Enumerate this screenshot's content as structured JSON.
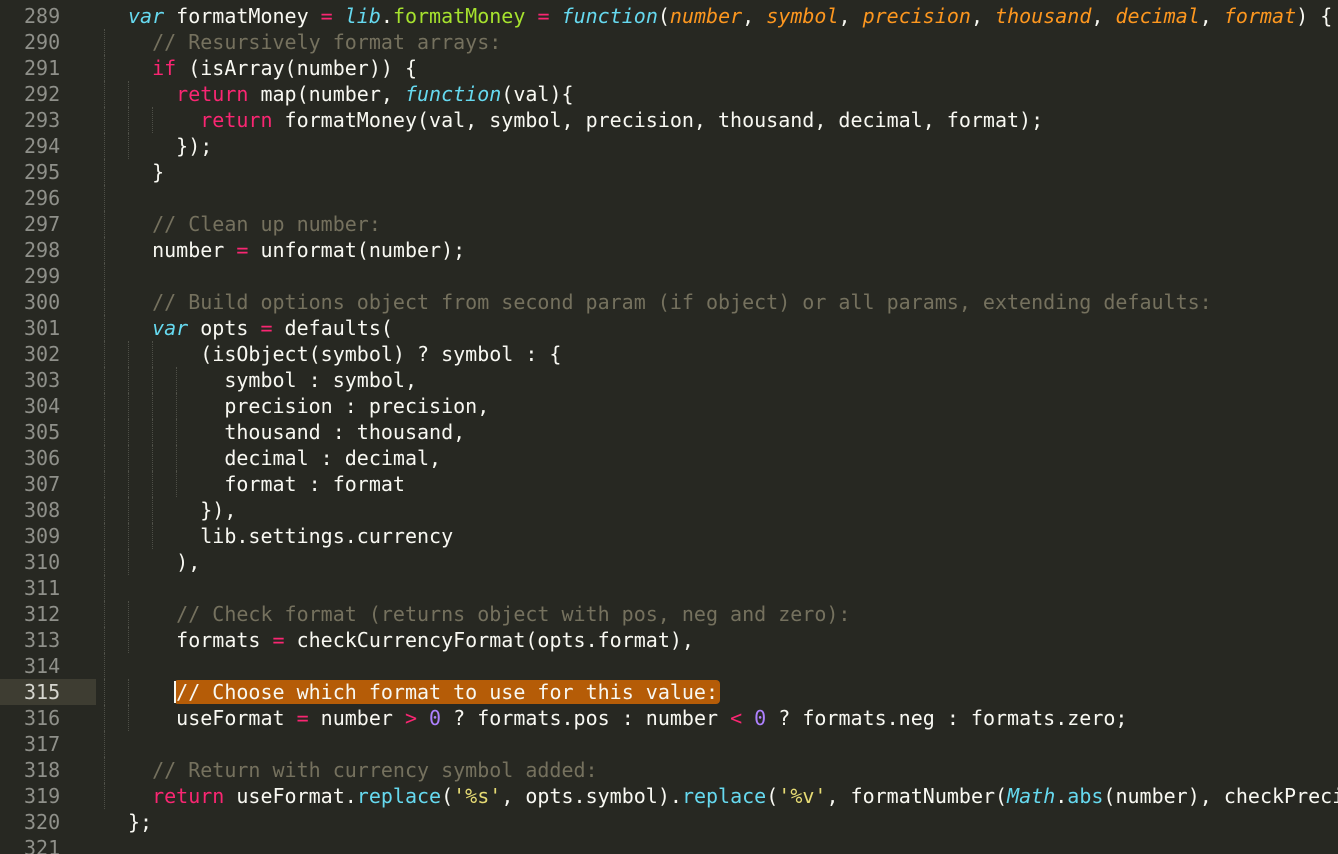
{
  "editor": {
    "active_line": 315,
    "colors": {
      "background": "#272822",
      "text": "#f8f8f2",
      "comment": "#75715e",
      "keyword": "#f92672",
      "storage": "#66d9ef",
      "function_name": "#a6e22e",
      "parameter": "#fd971f",
      "number": "#ae81ff",
      "string": "#e6db74",
      "line_number": "#8f908a",
      "selection_highlight": "#b55c07"
    },
    "lines": [
      {
        "number": "289",
        "tokens": [
          {
            "t": "var",
            "c": "storage"
          },
          {
            "t": " formatMoney ",
            "c": "plain"
          },
          {
            "t": "=",
            "c": "operator"
          },
          {
            "t": " ",
            "c": "plain"
          },
          {
            "t": "lib",
            "c": "storage"
          },
          {
            "t": ".",
            "c": "plain"
          },
          {
            "t": "formatMoney",
            "c": "func"
          },
          {
            "t": " ",
            "c": "plain"
          },
          {
            "t": "=",
            "c": "operator"
          },
          {
            "t": " ",
            "c": "plain"
          },
          {
            "t": "function",
            "c": "storage"
          },
          {
            "t": "(",
            "c": "plain"
          },
          {
            "t": "number",
            "c": "param"
          },
          {
            "t": ", ",
            "c": "plain"
          },
          {
            "t": "symbol",
            "c": "param"
          },
          {
            "t": ", ",
            "c": "plain"
          },
          {
            "t": "precision",
            "c": "param"
          },
          {
            "t": ", ",
            "c": "plain"
          },
          {
            "t": "thousand",
            "c": "param"
          },
          {
            "t": ", ",
            "c": "plain"
          },
          {
            "t": "decimal",
            "c": "param"
          },
          {
            "t": ", ",
            "c": "plain"
          },
          {
            "t": "format",
            "c": "param"
          },
          {
            "t": ") {",
            "c": "plain"
          }
        ]
      },
      {
        "number": "290",
        "tokens": [
          {
            "t": "  // Resursively format arrays:",
            "c": "comment"
          }
        ]
      },
      {
        "number": "291",
        "tokens": [
          {
            "t": "  ",
            "c": "plain"
          },
          {
            "t": "if",
            "c": "keyword"
          },
          {
            "t": " (isArray(number)) {",
            "c": "plain"
          }
        ]
      },
      {
        "number": "292",
        "tokens": [
          {
            "t": "    ",
            "c": "plain"
          },
          {
            "t": "return",
            "c": "keyword"
          },
          {
            "t": " map(number, ",
            "c": "plain"
          },
          {
            "t": "function",
            "c": "storage"
          },
          {
            "t": "(val){",
            "c": "plain"
          }
        ]
      },
      {
        "number": "293",
        "tokens": [
          {
            "t": "      ",
            "c": "plain"
          },
          {
            "t": "return",
            "c": "keyword"
          },
          {
            "t": " formatMoney(val, symbol, precision, thousand, decimal, format);",
            "c": "plain"
          }
        ]
      },
      {
        "number": "294",
        "tokens": [
          {
            "t": "    });",
            "c": "plain"
          }
        ]
      },
      {
        "number": "295",
        "tokens": [
          {
            "t": "  }",
            "c": "plain"
          }
        ]
      },
      {
        "number": "296",
        "tokens": []
      },
      {
        "number": "297",
        "tokens": [
          {
            "t": "  // Clean up number:",
            "c": "comment"
          }
        ]
      },
      {
        "number": "298",
        "tokens": [
          {
            "t": "  number ",
            "c": "plain"
          },
          {
            "t": "=",
            "c": "operator"
          },
          {
            "t": " unformat(number);",
            "c": "plain"
          }
        ]
      },
      {
        "number": "299",
        "tokens": []
      },
      {
        "number": "300",
        "tokens": [
          {
            "t": "  // Build options object from second param (if object) or all params, extending defaults:",
            "c": "comment"
          }
        ]
      },
      {
        "number": "301",
        "tokens": [
          {
            "t": "  ",
            "c": "plain"
          },
          {
            "t": "var",
            "c": "storage"
          },
          {
            "t": " opts ",
            "c": "plain"
          },
          {
            "t": "=",
            "c": "operator"
          },
          {
            "t": " defaults(",
            "c": "plain"
          }
        ]
      },
      {
        "number": "302",
        "tokens": [
          {
            "t": "      (isObject(symbol) ? symbol : {",
            "c": "plain"
          }
        ]
      },
      {
        "number": "303",
        "tokens": [
          {
            "t": "        symbol : symbol,",
            "c": "plain"
          }
        ]
      },
      {
        "number": "304",
        "tokens": [
          {
            "t": "        precision : precision,",
            "c": "plain"
          }
        ]
      },
      {
        "number": "305",
        "tokens": [
          {
            "t": "        thousand : thousand,",
            "c": "plain"
          }
        ]
      },
      {
        "number": "306",
        "tokens": [
          {
            "t": "        decimal : decimal,",
            "c": "plain"
          }
        ]
      },
      {
        "number": "307",
        "tokens": [
          {
            "t": "        format : format",
            "c": "plain"
          }
        ]
      },
      {
        "number": "308",
        "tokens": [
          {
            "t": "      }),",
            "c": "plain"
          }
        ]
      },
      {
        "number": "309",
        "tokens": [
          {
            "t": "      lib.settings.currency",
            "c": "plain"
          }
        ]
      },
      {
        "number": "310",
        "tokens": [
          {
            "t": "    ),",
            "c": "plain"
          }
        ]
      },
      {
        "number": "311",
        "tokens": []
      },
      {
        "number": "312",
        "tokens": [
          {
            "t": "    // Check format (returns object with pos, neg and zero):",
            "c": "comment"
          }
        ]
      },
      {
        "number": "313",
        "tokens": [
          {
            "t": "    formats ",
            "c": "plain"
          },
          {
            "t": "=",
            "c": "operator"
          },
          {
            "t": " checkCurrencyFormat(opts.format),",
            "c": "plain"
          }
        ]
      },
      {
        "number": "314",
        "tokens": []
      },
      {
        "number": "315",
        "tokens": [
          {
            "t": "    ",
            "c": "plain"
          },
          {
            "t": "// Choose which format to use for this value:",
            "c": "hl"
          }
        ]
      },
      {
        "number": "316",
        "tokens": [
          {
            "t": "    useFormat ",
            "c": "plain"
          },
          {
            "t": "=",
            "c": "operator"
          },
          {
            "t": " number ",
            "c": "plain"
          },
          {
            "t": ">",
            "c": "operator"
          },
          {
            "t": " ",
            "c": "plain"
          },
          {
            "t": "0",
            "c": "number"
          },
          {
            "t": " ? formats.pos : number ",
            "c": "plain"
          },
          {
            "t": "<",
            "c": "operator"
          },
          {
            "t": " ",
            "c": "plain"
          },
          {
            "t": "0",
            "c": "number"
          },
          {
            "t": " ? formats.neg : formats.zero;",
            "c": "plain"
          }
        ]
      },
      {
        "number": "317",
        "tokens": []
      },
      {
        "number": "318",
        "tokens": [
          {
            "t": "  // Return with currency symbol added:",
            "c": "comment"
          }
        ]
      },
      {
        "number": "319",
        "tokens": [
          {
            "t": "  ",
            "c": "plain"
          },
          {
            "t": "return",
            "c": "keyword"
          },
          {
            "t": " useFormat.",
            "c": "plain"
          },
          {
            "t": "replace",
            "c": "support"
          },
          {
            "t": "(",
            "c": "plain"
          },
          {
            "t": "'%s'",
            "c": "string"
          },
          {
            "t": ", opts.symbol).",
            "c": "plain"
          },
          {
            "t": "replace",
            "c": "support"
          },
          {
            "t": "(",
            "c": "plain"
          },
          {
            "t": "'%v'",
            "c": "string"
          },
          {
            "t": ", formatNumber(",
            "c": "plain"
          },
          {
            "t": "Math",
            "c": "supportclass"
          },
          {
            "t": ".",
            "c": "plain"
          },
          {
            "t": "abs",
            "c": "support"
          },
          {
            "t": "(number), checkPrecision(opts.precision), opts.thousand, opts.decimal));",
            "c": "plain"
          }
        ]
      },
      {
        "number": "320",
        "tokens": [
          {
            "t": "};",
            "c": "plain"
          }
        ]
      },
      {
        "number": "321",
        "tokens": []
      }
    ]
  }
}
